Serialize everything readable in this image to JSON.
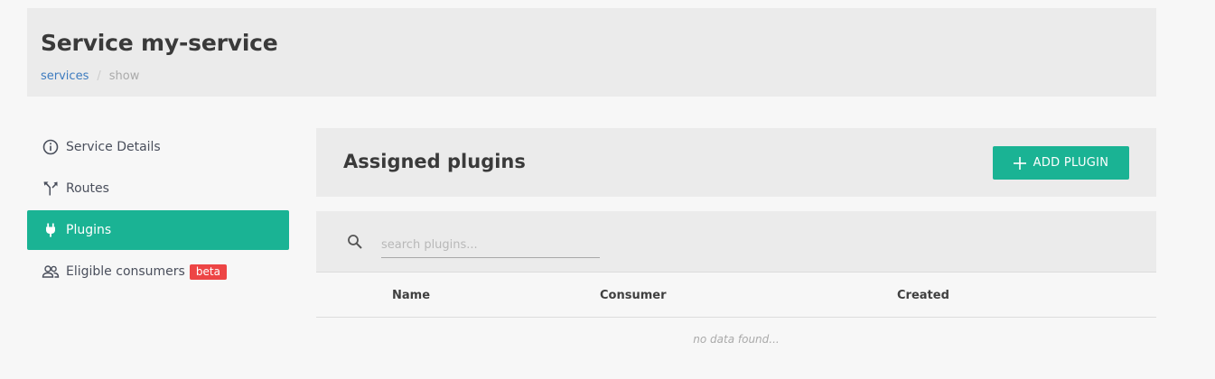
{
  "header": {
    "title": "Service my-service",
    "breadcrumb": {
      "link": "services",
      "separator": "/",
      "current": "show"
    }
  },
  "sidebar": {
    "items": [
      {
        "label": "Service Details",
        "icon": "info-circle-icon"
      },
      {
        "label": "Routes",
        "icon": "routes-fork-icon"
      },
      {
        "label": "Plugins",
        "icon": "plug-icon",
        "active": true
      },
      {
        "label": "Eligible consumers",
        "icon": "users-icon",
        "badge": "beta"
      }
    ]
  },
  "plugins": {
    "title": "Assigned plugins",
    "add_label": "ADD PLUGIN",
    "search_placeholder": "search plugins...",
    "columns": [
      "Name",
      "Consumer",
      "Created"
    ],
    "empty_text": "no data found..."
  },
  "colors": {
    "accent": "#1ab394",
    "badge": "#ed4545",
    "link": "#3d7bbf"
  }
}
